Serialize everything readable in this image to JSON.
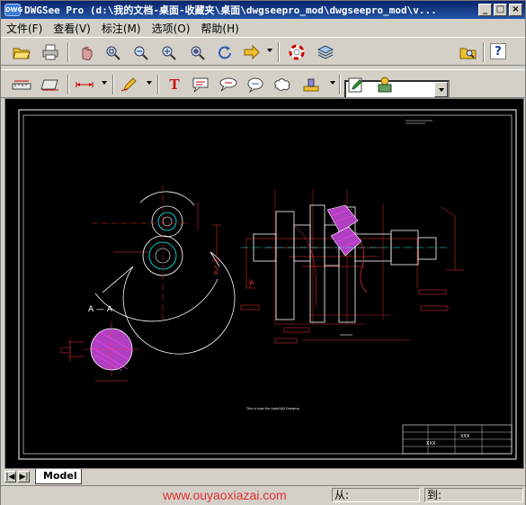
{
  "window": {
    "app_logo": "DWG",
    "title": "DWGSee Pro  (d:\\我的文档-桌面-收藏夹\\桌面\\dwgseepro_mod\\dwgseepro_mod\\v...",
    "buttons": [
      "_",
      "□",
      "×"
    ]
  },
  "menu": [
    {
      "label": "文件(F)"
    },
    {
      "label": "查看(V)"
    },
    {
      "label": "标注(M)"
    },
    {
      "label": "选项(O)"
    },
    {
      "label": "帮助(H)"
    }
  ],
  "toolbar1": {
    "icons": [
      "open-folder-icon",
      "print-icon",
      "pan-icon",
      "zoom-window-icon",
      "zoom-out-icon",
      "zoom-in-icon",
      "zoom-extents-icon",
      "rotate-icon",
      "next-arrow-icon",
      "lifebuoy-icon",
      "layers-icon",
      "browse-folder-icon",
      "help-icon"
    ],
    "combo_value": "",
    "help_label": "?"
  },
  "toolbar2": {
    "text_tool_label": "T"
  },
  "drawing": {
    "section_label": "A — A",
    "view_note": "This is how the AutoCAD Drawing",
    "title_block_cells": [
      "XXX",
      "XXX"
    ],
    "colors": {
      "background": "#000000",
      "outline": "#ffffff",
      "dims": "#ff3030",
      "center": "#00ffff",
      "hatch": "#ff00ff",
      "text": "#ffffff"
    }
  },
  "tabs": {
    "nav": [
      "|◀",
      "▶|"
    ],
    "model_label": "Model"
  },
  "status": {
    "watermark": "www.ouyaoxiazai.com",
    "from_label": "从:",
    "to_label": "到:"
  }
}
